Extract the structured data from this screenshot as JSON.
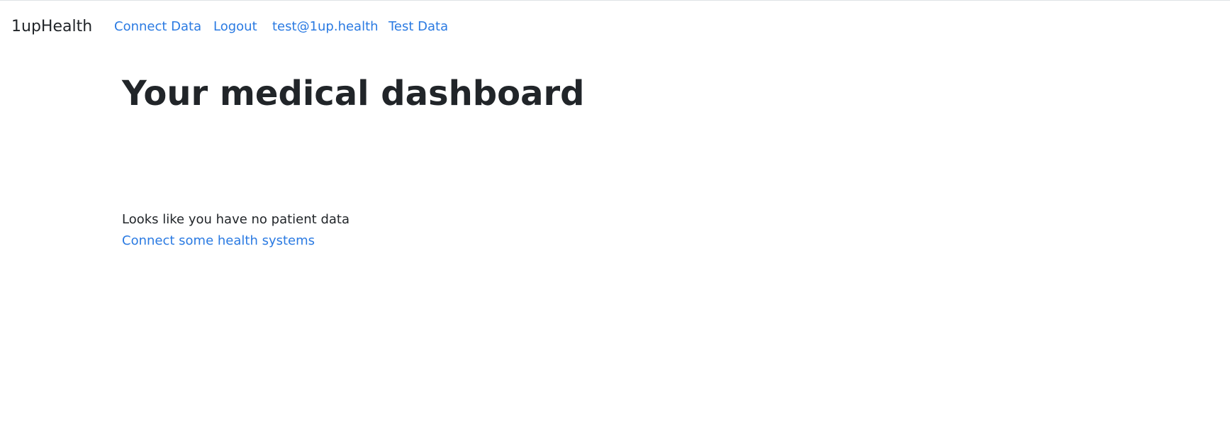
{
  "navbar": {
    "brand": "1upHealth",
    "links": [
      {
        "label": "Connect Data"
      },
      {
        "label": "Logout"
      },
      {
        "label": "test@1up.health"
      },
      {
        "label": "Test Data"
      }
    ]
  },
  "main": {
    "title": "Your medical dashboard",
    "empty_message": "Looks like you have no patient data",
    "empty_link": "Connect some health systems"
  },
  "colors": {
    "link": "#2a7ae2",
    "text": "#212529",
    "background": "#ffffff"
  }
}
